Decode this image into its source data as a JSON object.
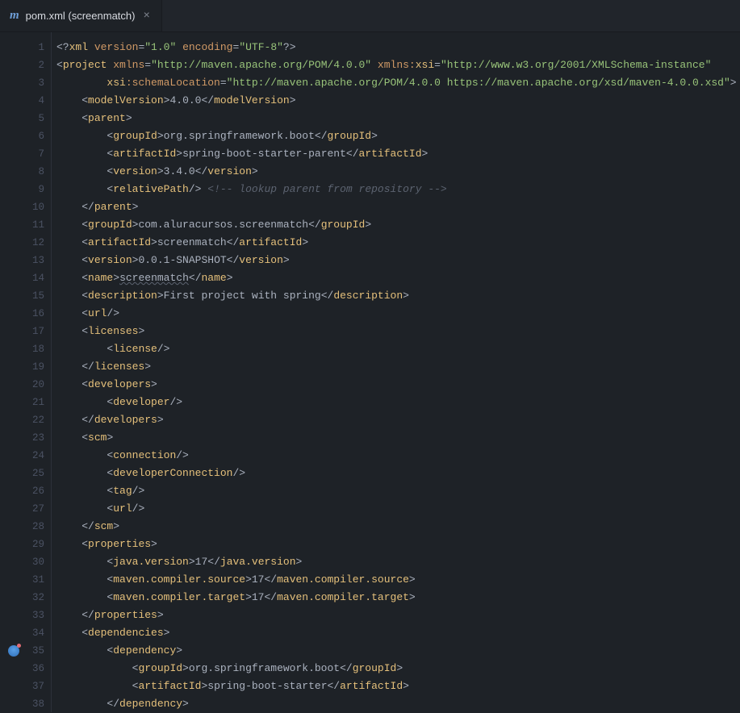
{
  "tab": {
    "icon": "m",
    "label": "pom.xml (screenmatch)",
    "close": "×"
  },
  "lines": {
    "count": 38,
    "gutterMarkAt": 35
  },
  "xml": {
    "decl": {
      "version": "1.0",
      "encoding": "UTF-8"
    },
    "project": {
      "xmlns": "http://maven.apache.org/POM/4.0.0",
      "xmlns_xsi": "http://www.w3.org/2001/XMLSchema-instance",
      "schemaLocation": "http://maven.apache.org/POM/4.0.0 https://maven.apache.org/xsd/maven-4.0.0.xsd"
    },
    "modelVersion": "4.0.0",
    "parent": {
      "groupId": "org.springframework.boot",
      "artifactId": "spring-boot-starter-parent",
      "version": "3.4.0",
      "relativePathComment": " lookup parent from repository "
    },
    "groupId": "com.aluracursos.screenmatch",
    "artifactId": "screenmatch",
    "version": "0.0.1-SNAPSHOT",
    "name": "screenmatch",
    "description": "First project with spring",
    "properties": {
      "javaVersion": "17",
      "compilerSource": "17",
      "compilerTarget": "17"
    },
    "dependency": {
      "groupId": "org.springframework.boot",
      "artifactId": "spring-boot-starter"
    }
  }
}
